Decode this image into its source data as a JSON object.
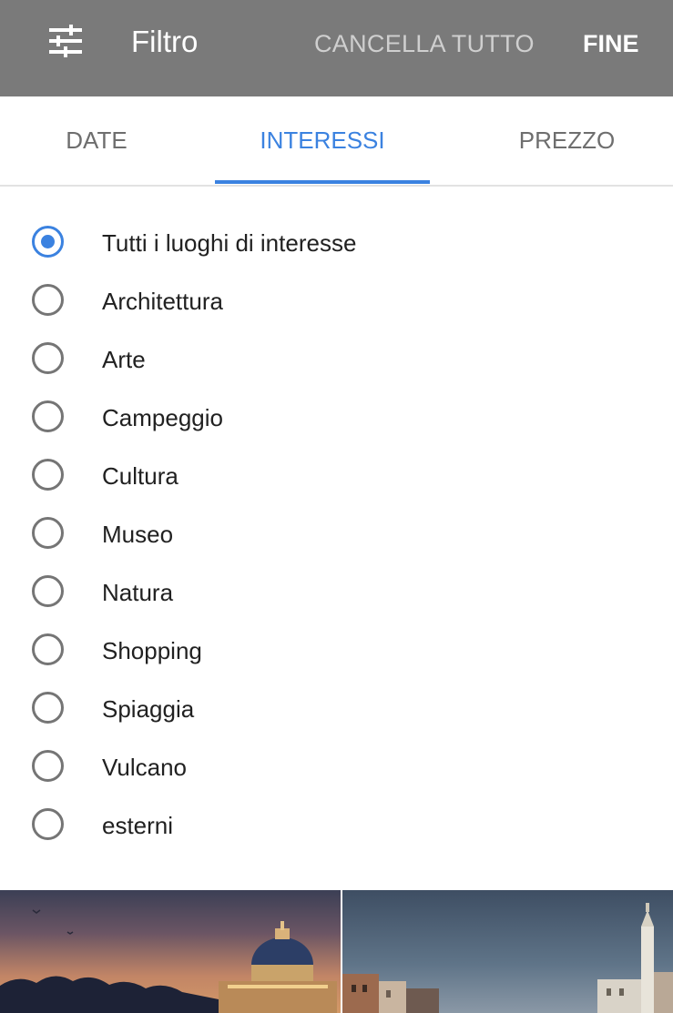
{
  "header": {
    "icon": "tune-sliders-icon",
    "title": "Filtro",
    "clear_label": "CANCELLA TUTTO",
    "done_label": "FINE"
  },
  "tabs": [
    {
      "label": "DATE",
      "active": false
    },
    {
      "label": "INTERESSI",
      "active": true
    },
    {
      "label": "PREZZO",
      "active": false
    }
  ],
  "interests": {
    "selected_index": 0,
    "options": [
      "Tutti i luoghi di interesse",
      "Architettura",
      "Arte",
      "Campeggio",
      "Cultura",
      "Museo",
      "Natura",
      "Shopping",
      "Spiaggia",
      "Vulcano",
      "esterni"
    ]
  },
  "colors": {
    "header_bg": "#7a7a7a",
    "accent": "#3b82e0"
  },
  "images": [
    {
      "name": "rome-skyline-dusk-photo"
    },
    {
      "name": "venice-canal-photo"
    }
  ]
}
